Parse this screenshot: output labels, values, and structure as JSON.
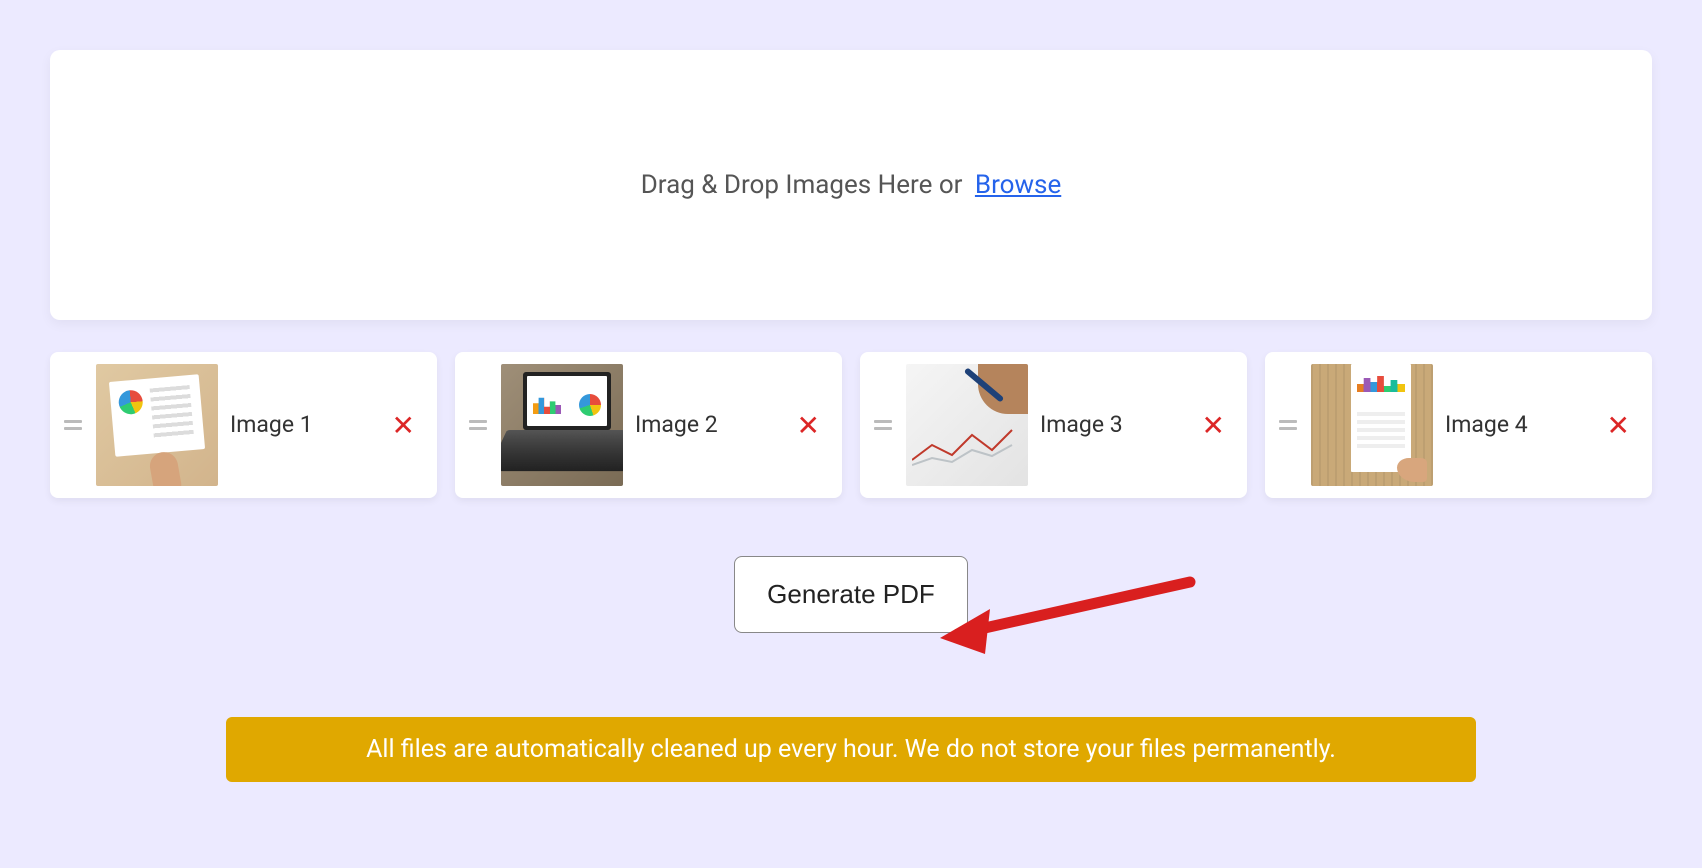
{
  "dropzone": {
    "text": "Drag & Drop Images Here or",
    "browse_label": "Browse"
  },
  "images": [
    {
      "label": "Image 1",
      "icon": "remove-icon"
    },
    {
      "label": "Image 2",
      "icon": "remove-icon"
    },
    {
      "label": "Image 3",
      "icon": "remove-icon"
    },
    {
      "label": "Image 4",
      "icon": "remove-icon"
    }
  ],
  "generate_button_label": "Generate PDF",
  "notice_text": "All files are automatically cleaned up every hour. We do not store your files permanently."
}
